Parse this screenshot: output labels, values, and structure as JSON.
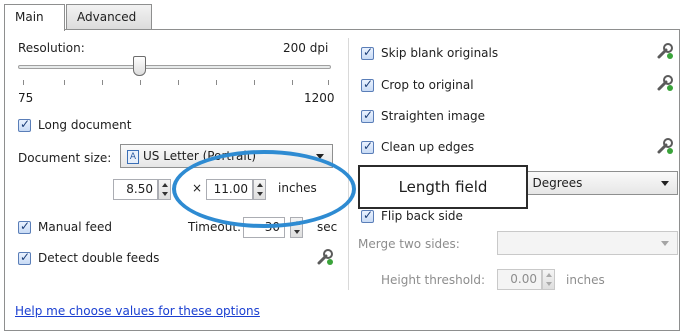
{
  "tabs": [
    "Main",
    "Advanced"
  ],
  "resolution": {
    "label": "Resolution:",
    "value": "200 dpi",
    "min": "75",
    "max": "1200"
  },
  "long_document": {
    "label": "Long document",
    "checked": true
  },
  "document_size": {
    "label": "Document size:",
    "value": "US Letter (Portrait)"
  },
  "size": {
    "width": "8.50",
    "times": "×",
    "length": "11.00",
    "unit": "inches"
  },
  "manual_feed": {
    "label": "Manual feed",
    "checked": true,
    "timeout_label": "Timeout:",
    "timeout_value": "30",
    "unit": "sec"
  },
  "detect_double_feeds": {
    "label": "Detect double feeds",
    "checked": true
  },
  "right": {
    "skip_blank": "Skip blank originals",
    "crop": "Crop to original",
    "straighten": "Straighten image",
    "clean_edges": "Clean up edges",
    "rotation_value": "0 Degrees",
    "flip_back": "Flip back side",
    "merge_label": "Merge two sides:",
    "height_label": "Height threshold:",
    "height_value": "0.00",
    "height_unit": "inches"
  },
  "callout": "Length field",
  "help_link": "Help me choose values for these options",
  "colors": {
    "highlight": "#2e8bd2",
    "link": "#1a3fd1",
    "check": "#5a7eb8"
  }
}
